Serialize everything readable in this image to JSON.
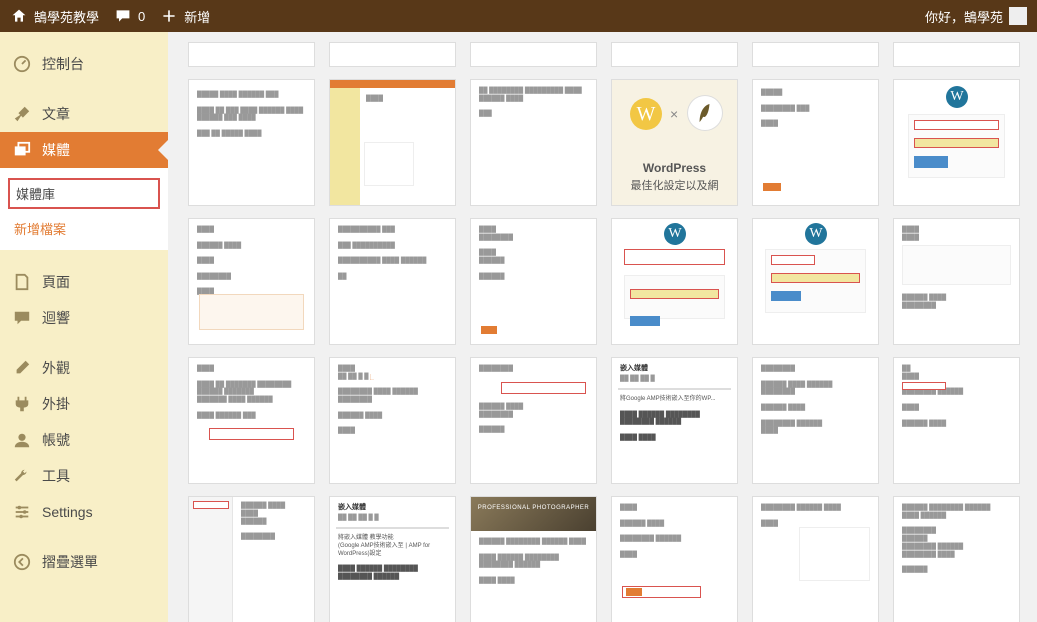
{
  "adminbar": {
    "site_name": "鵠學苑教學",
    "comments_count": "0",
    "new_label": "新增",
    "greeting": "你好，鵠學苑"
  },
  "sidebar": {
    "dashboard": "控制台",
    "posts": "文章",
    "media": "媒體",
    "media_library": "媒體庫",
    "media_new": "新增檔案",
    "pages": "頁面",
    "comments": "迴響",
    "appearance": "外觀",
    "plugins": "外掛",
    "users": "帳號",
    "tools": "工具",
    "settings": "Settings",
    "collapse": "摺疊選單"
  },
  "thumb_texts": {
    "wp_card_line1": "WordPress",
    "wp_card_line2": "最佳化設定以及網"
  }
}
